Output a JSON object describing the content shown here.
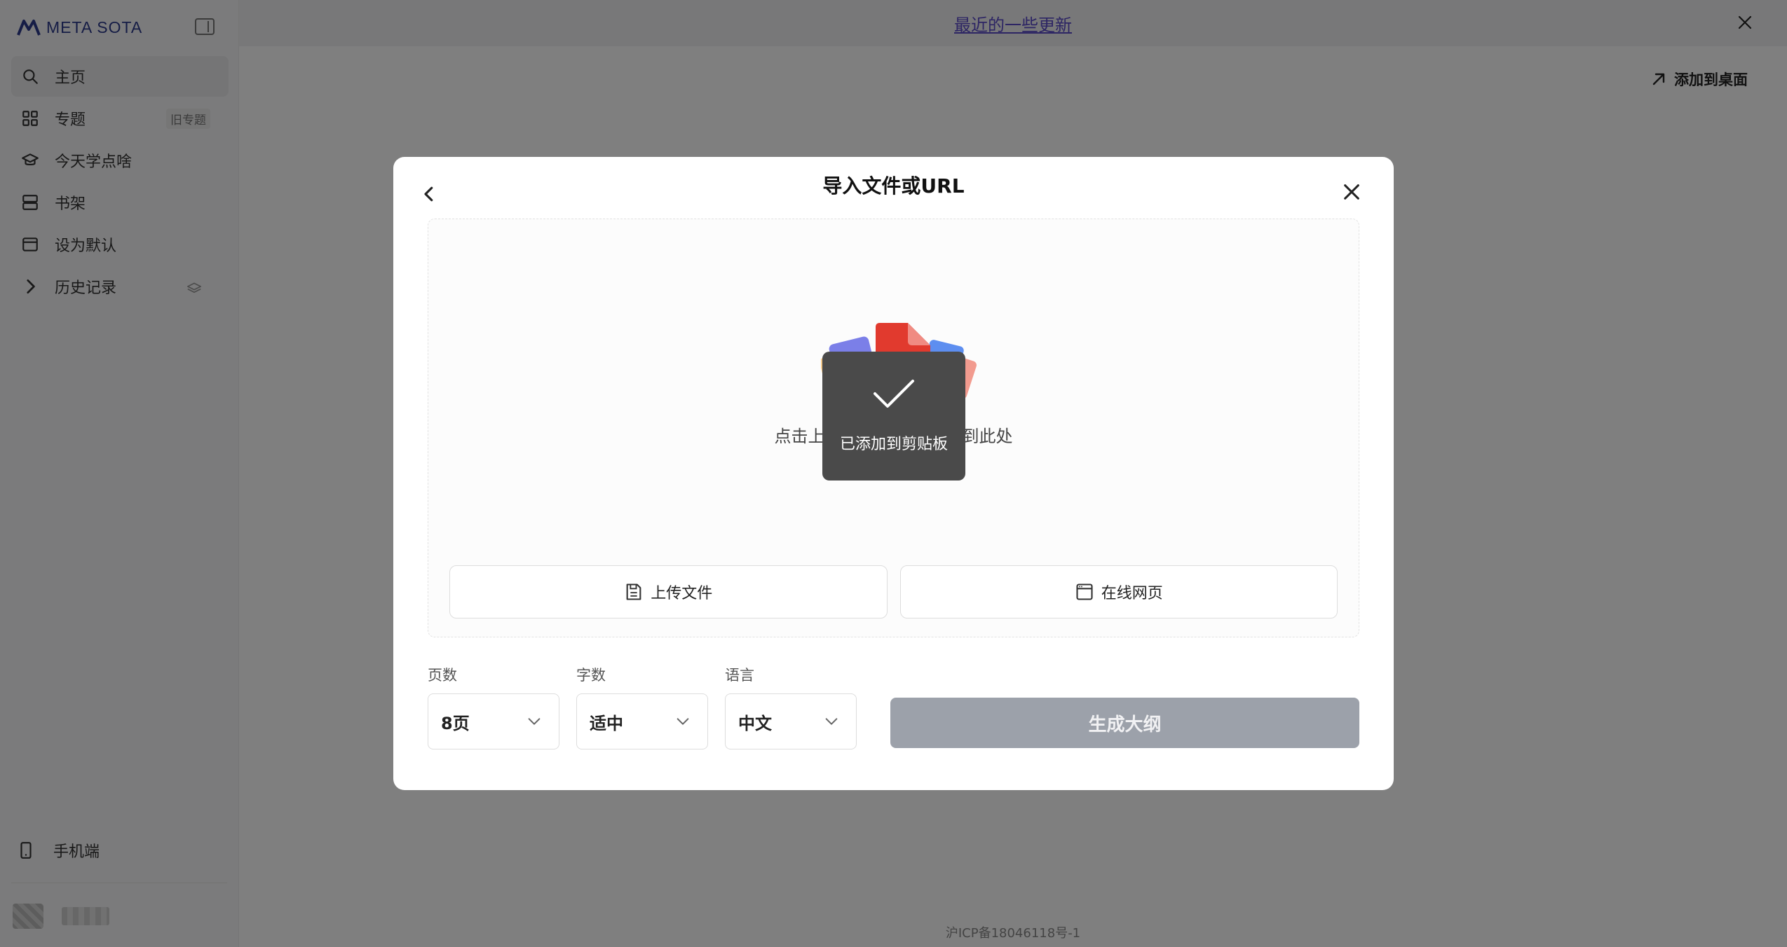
{
  "brand": {
    "name": "META SOTA"
  },
  "sidebar": {
    "items": [
      {
        "label": "主页",
        "icon": "search-icon",
        "active": true
      },
      {
        "label": "专题",
        "icon": "grid-icon",
        "badge": "旧专题"
      },
      {
        "label": "今天学点啥",
        "icon": "graduation-cap-icon"
      },
      {
        "label": "书架",
        "icon": "bookshelf-icon"
      },
      {
        "label": "设为默认",
        "icon": "browser-window-icon"
      },
      {
        "label": "历史记录",
        "icon": "chevron-right-icon",
        "trail_icon": "layers-icon"
      }
    ],
    "mobile_label": "手机端"
  },
  "topbar": {
    "update_link": "最近的一些更新"
  },
  "main": {
    "add_to_desktop": "添加到桌面",
    "icp": "沪ICP备18046118号-1"
  },
  "modal": {
    "title": "导入文件或URL",
    "drop_hint_left": "点击上",
    "drop_hint_right": "到此处",
    "upload_label": "上传文件",
    "webpage_label": "在线网页",
    "options": {
      "pages": {
        "label": "页数",
        "value": "8页"
      },
      "words": {
        "label": "字数",
        "value": "适中"
      },
      "language": {
        "label": "语言",
        "value": "中文"
      }
    },
    "generate_label": "生成大纲"
  },
  "toast": {
    "text": "已添加到剪贴板"
  },
  "colors": {
    "accent": "#5b4bc9",
    "brand": "#2d3a8c",
    "generate_disabled": "#9ca1aa",
    "toast_bg": "#4a4a4a"
  }
}
